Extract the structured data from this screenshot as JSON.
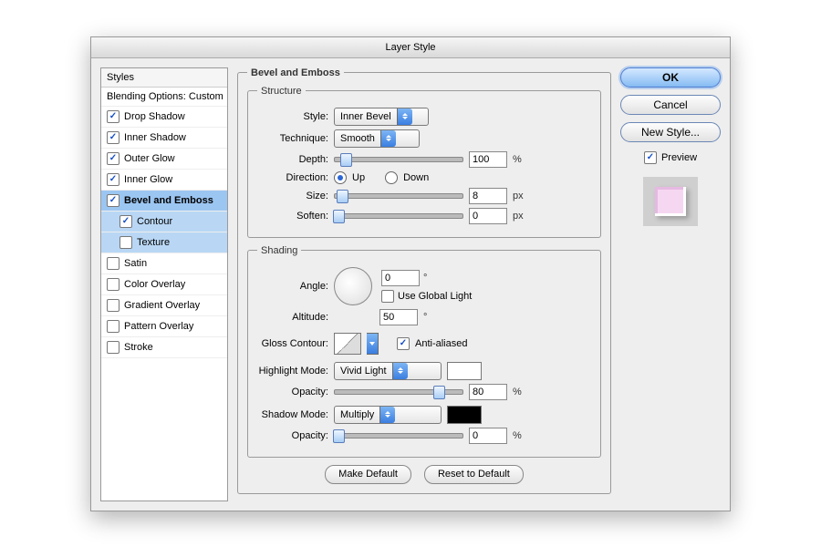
{
  "title": "Layer Style",
  "styles": {
    "header": "Styles",
    "blending": "Blending Options: Custom",
    "items": [
      {
        "label": "Drop Shadow",
        "checked": true,
        "selected": false,
        "sub": false
      },
      {
        "label": "Inner Shadow",
        "checked": true,
        "selected": false,
        "sub": false
      },
      {
        "label": "Outer Glow",
        "checked": true,
        "selected": false,
        "sub": false
      },
      {
        "label": "Inner Glow",
        "checked": true,
        "selected": false,
        "sub": false
      },
      {
        "label": "Bevel and Emboss",
        "checked": true,
        "selected": true,
        "sub": false,
        "bold": true
      },
      {
        "label": "Contour",
        "checked": true,
        "selected": true,
        "sub": true
      },
      {
        "label": "Texture",
        "checked": false,
        "selected": true,
        "sub": true
      },
      {
        "label": "Satin",
        "checked": false,
        "selected": false,
        "sub": false
      },
      {
        "label": "Color Overlay",
        "checked": false,
        "selected": false,
        "sub": false
      },
      {
        "label": "Gradient Overlay",
        "checked": false,
        "selected": false,
        "sub": false
      },
      {
        "label": "Pattern Overlay",
        "checked": false,
        "selected": false,
        "sub": false
      },
      {
        "label": "Stroke",
        "checked": false,
        "selected": false,
        "sub": false
      }
    ]
  },
  "panel": {
    "title": "Bevel and Emboss",
    "structure": {
      "legend": "Structure",
      "style_label": "Style:",
      "style_value": "Inner Bevel",
      "technique_label": "Technique:",
      "technique_value": "Smooth",
      "depth_label": "Depth:",
      "depth_value": "100",
      "depth_unit": "%",
      "direction_label": "Direction:",
      "direction_up": "Up",
      "direction_down": "Down",
      "direction_value": "up",
      "size_label": "Size:",
      "size_value": "8",
      "size_unit": "px",
      "soften_label": "Soften:",
      "soften_value": "0",
      "soften_unit": "px"
    },
    "shading": {
      "legend": "Shading",
      "angle_label": "Angle:",
      "angle_value": "0",
      "angle_unit": "°",
      "global_light_label": "Use Global Light",
      "global_light_checked": false,
      "altitude_label": "Altitude:",
      "altitude_value": "50",
      "altitude_unit": "°",
      "gloss_label": "Gloss Contour:",
      "antialiased_label": "Anti-aliased",
      "antialiased_checked": true,
      "highlight_mode_label": "Highlight Mode:",
      "highlight_mode_value": "Vivid Light",
      "highlight_color": "#ffffff",
      "highlight_opacity_label": "Opacity:",
      "highlight_opacity_value": "80",
      "highlight_opacity_unit": "%",
      "shadow_mode_label": "Shadow Mode:",
      "shadow_mode_value": "Multiply",
      "shadow_color": "#000000",
      "shadow_opacity_label": "Opacity:",
      "shadow_opacity_value": "0",
      "shadow_opacity_unit": "%"
    },
    "make_default": "Make Default",
    "reset_default": "Reset to Default"
  },
  "buttons": {
    "ok": "OK",
    "cancel": "Cancel",
    "new_style": "New Style...",
    "preview": "Preview",
    "preview_checked": true
  }
}
